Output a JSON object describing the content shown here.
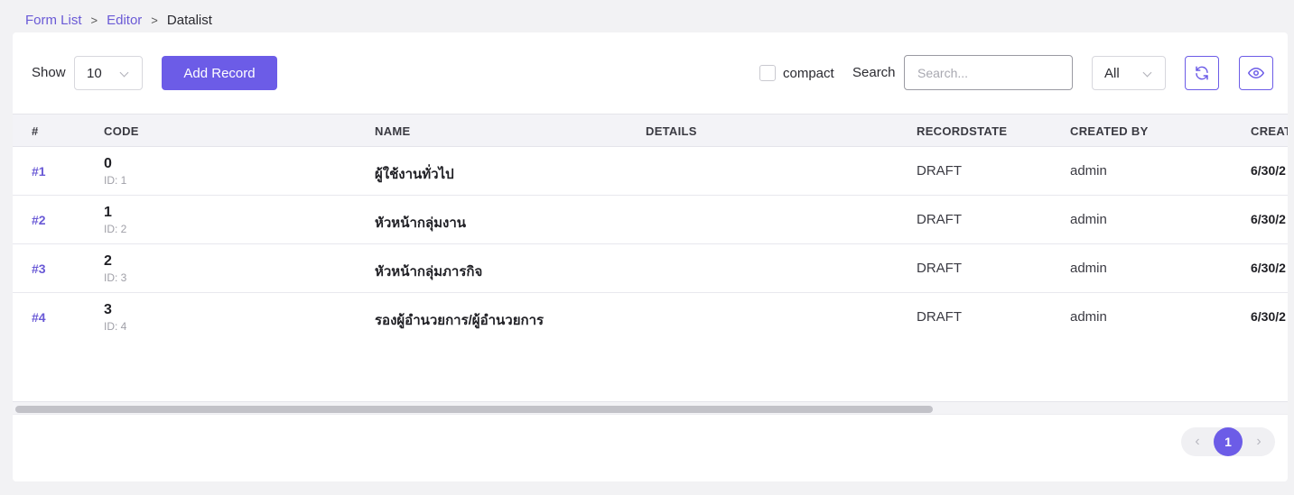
{
  "breadcrumb": {
    "items": [
      "Form List",
      "Editor",
      "Datalist"
    ]
  },
  "toolbar": {
    "show_label": "Show",
    "page_size": "10",
    "add_button": "Add Record",
    "compact_label": "compact",
    "search_label": "Search",
    "search_placeholder": "Search...",
    "state_filter": "All"
  },
  "table": {
    "headers": [
      "#",
      "CODE",
      "NAME",
      "DETAILS",
      "RECORDSTATE",
      "CREATED BY",
      "CREAT"
    ],
    "rows": [
      {
        "num": "#1",
        "code": "0",
        "id": "ID: 1",
        "name": "ผู้ใช้งานทั่วไป",
        "details": "",
        "state": "DRAFT",
        "created_by": "admin",
        "created_at": "6/30/2"
      },
      {
        "num": "#2",
        "code": "1",
        "id": "ID: 2",
        "name": "หัวหน้ากลุ่มงาน",
        "details": "",
        "state": "DRAFT",
        "created_by": "admin",
        "created_at": "6/30/2"
      },
      {
        "num": "#3",
        "code": "2",
        "id": "ID: 3",
        "name": "หัวหน้ากลุ่มภารกิจ",
        "details": "",
        "state": "DRAFT",
        "created_by": "admin",
        "created_at": "6/30/2"
      },
      {
        "num": "#4",
        "code": "3",
        "id": "ID: 4",
        "name": "รองผู้อำนวยการ/ผู้อำนวยการ",
        "details": "",
        "state": "DRAFT",
        "created_by": "admin",
        "created_at": "6/30/2"
      }
    ]
  },
  "pagination": {
    "prev": "‹",
    "current": "1",
    "next": "›"
  },
  "colors": {
    "accent": "#6c5ce7",
    "link": "#6a5ad6",
    "header_bg": "#f3f3f7",
    "page_bg": "#f2f2f4"
  },
  "icons": {
    "refresh": "refresh-icon",
    "view": "eye-icon",
    "dropdown": "chevron-down-icon"
  }
}
